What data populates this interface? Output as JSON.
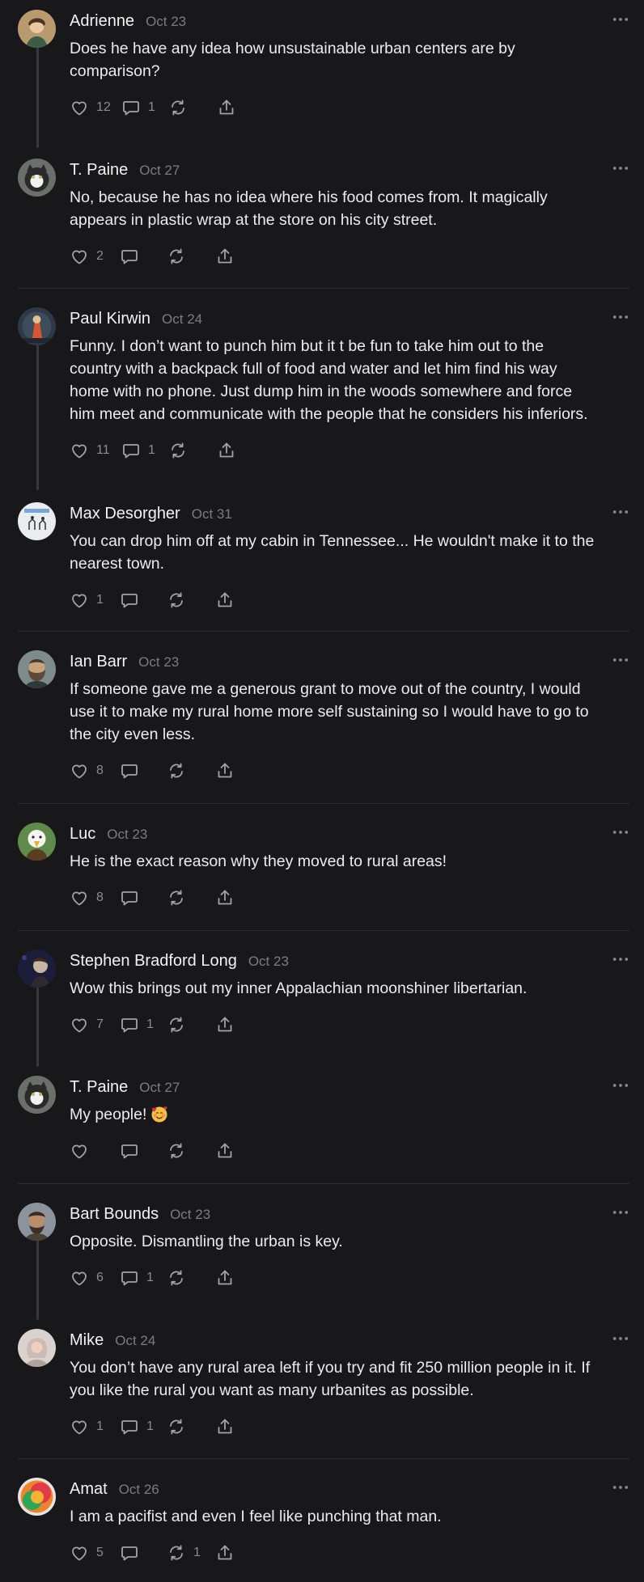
{
  "posts": [
    {
      "name": "Adrienne",
      "date": "Oct 23",
      "text": "Does he have any idea how unsustainable urban centers are by\ncomparison?",
      "likes": "12",
      "comments": "1",
      "reposts": ""
    },
    {
      "name": "T. Paine",
      "date": "Oct 27",
      "text": "No, because he has no idea where his food comes from. It magically\nappears in plastic wrap at the store on his city street.",
      "likes": "2",
      "comments": "",
      "reposts": ""
    },
    {
      "name": "Paul Kirwin",
      "date": "Oct 24",
      "text": "Funny. I don’t want to punch him but it t be fun to take him out to the\ncountry with a backpack full of food and water and let him find his way\nhome with no phone. Just dump him in the woods somewhere and force\nhim meet and communicate with the people that he considers his inferiors.",
      "likes": "11",
      "comments": "1",
      "reposts": ""
    },
    {
      "name": "Max Desorgher",
      "date": "Oct 31",
      "text": "You can drop him off at my cabin in Tennessee... He wouldn't make it to the\nnearest town.",
      "likes": "1",
      "comments": "",
      "reposts": ""
    },
    {
      "name": "Ian Barr",
      "date": "Oct 23",
      "text": "If someone gave me a generous grant to move out of the country, I would\nuse it to make my rural home more self sustaining so I would have to go to\nthe city even less.",
      "likes": "8",
      "comments": "",
      "reposts": ""
    },
    {
      "name": "Luc",
      "date": "Oct 23",
      "text": "He is the exact reason why they moved to rural areas!",
      "likes": "8",
      "comments": "",
      "reposts": ""
    },
    {
      "name": "Stephen Bradford Long",
      "date": "Oct 23",
      "text": "Wow this brings out my inner Appalachian moonshiner libertarian.",
      "likes": "7",
      "comments": "1",
      "reposts": ""
    },
    {
      "name": "T. Paine",
      "date": "Oct 27",
      "text": "My people!",
      "emoji": "🥰",
      "likes": "",
      "comments": "",
      "reposts": ""
    },
    {
      "name": "Bart Bounds",
      "date": "Oct 23",
      "text": "Opposite. Dismantling the urban is key.",
      "likes": "6",
      "comments": "1",
      "reposts": ""
    },
    {
      "name": "Mike",
      "date": "Oct 24",
      "text": "You don’t have any rural area left if you try and fit 250 million people in it. If\nyou like the rural you want as many urbanites as possible.",
      "likes": "1",
      "comments": "1",
      "reposts": ""
    },
    {
      "name": "Amat",
      "date": "Oct 26",
      "text": "I am a pacifist and even I feel like punching that man.",
      "likes": "5",
      "comments": "",
      "reposts": "1"
    }
  ]
}
